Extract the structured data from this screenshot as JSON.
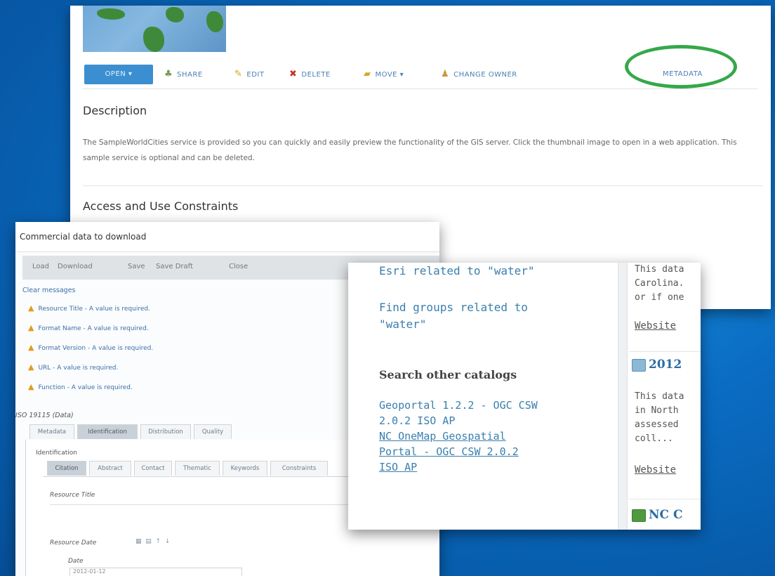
{
  "item_page": {
    "toolbar": {
      "open": "OPEN ▾",
      "share": "SHARE",
      "edit": "EDIT",
      "delete": "DELETE",
      "move": "MOVE ▾",
      "change_owner": "CHANGE OWNER",
      "metadata": "METADATA"
    },
    "description_heading": "Description",
    "description_text": "The SampleWorldCities service is provided so you can quickly and easily preview the functionality of the GIS server. Click the thumbnail image to open in a web application. This sample service is optional and can be deleted.",
    "access_heading": "Access and Use Constraints",
    "highlight_color": "#35a84a"
  },
  "editor": {
    "title": "Commercial data to download",
    "toolbar": [
      "Load",
      "Download",
      "Save",
      "Save Draft",
      "Close"
    ],
    "clear_messages": "Clear messages",
    "warnings": [
      "Resource Title - A value is required.",
      "Format Name - A value is required.",
      "Format Version - A value is required.",
      "URL - A value is required.",
      "Function - A value is required."
    ],
    "standard": "ISO 19115 (Data)",
    "tabs": [
      "Metadata",
      "Identification",
      "Distribution",
      "Quality"
    ],
    "active_tab": "Identification",
    "section": "Identification",
    "subtabs": [
      "Citation",
      "Abstract",
      "Contact",
      "Thematic",
      "Keywords",
      "Constraints"
    ],
    "active_subtab": "Citation",
    "resource_title_label": "Resource Title",
    "resource_date_label": "Resource Date",
    "date_label": "Date",
    "date_value": "2012-01-12"
  },
  "search": {
    "related_esri": "Esri related to \"water\"",
    "find_groups_line1": "Find groups related to",
    "find_groups_line2": "\"water\"",
    "other_catalogs_heading": "Search other catalogs",
    "catalogs": [
      "Geoportal 1.2.2 - OGC CSW",
      "2.0.2 ISO AP",
      "NC OneMap Geospatial",
      "Portal - OGC CSW 2.0.2",
      "ISO AP"
    ],
    "cards": [
      {
        "text": "This data\nCarolina.\nor if one",
        "link": "Website"
      },
      {
        "title": "2012",
        "text": "This data\nin North\nassessed\ncoll...",
        "link": "Website"
      },
      {
        "title": "NC C"
      }
    ]
  }
}
